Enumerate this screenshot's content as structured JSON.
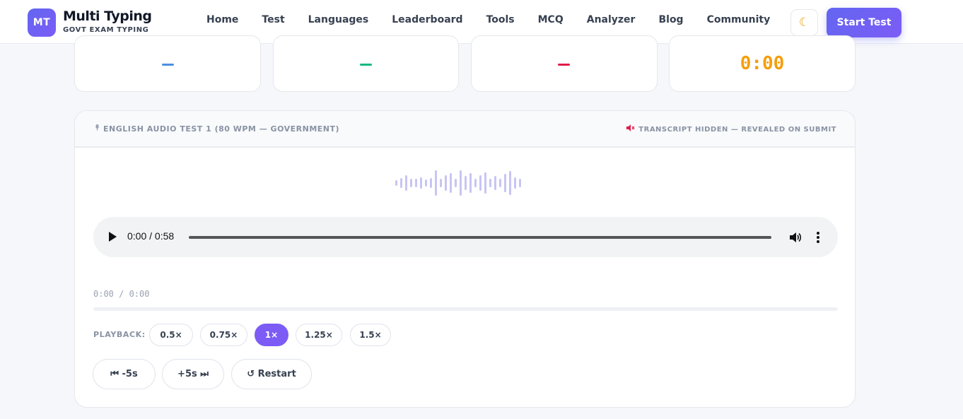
{
  "brand": {
    "badge": "MT",
    "name": "Multi Typing",
    "subtitle": "GOVT EXAM TYPING"
  },
  "nav": [
    "Home",
    "Test",
    "Languages",
    "Leaderboard",
    "Tools",
    "MCQ",
    "Analyzer",
    "Blog",
    "Community"
  ],
  "header": {
    "theme_icon": "moon-icon",
    "start_label": "Start Test"
  },
  "stats": [
    {
      "value": "",
      "color": "#4a90e2"
    },
    {
      "value": "",
      "color": "#10b981"
    },
    {
      "value": "",
      "color": "#e11d48"
    },
    {
      "value": "0:00",
      "color": "#f59e0b"
    }
  ],
  "audio_panel": {
    "title": "ENGLISH AUDIO TEST 1 (80 WPM — GOVERNMENT)",
    "title_icon": "mic-icon",
    "notice": "TRANSCRIPT HIDDEN — REVEALED ON SUBMIT",
    "notice_icon": "muted-speaker-icon",
    "player_time": "0:00 / 0:58",
    "elapsed": "0:00 / 0:00",
    "progress": 0,
    "playback_label": "PLAYBACK:",
    "speeds": [
      "0.5×",
      "0.75×",
      "1×",
      "1.25×",
      "1.5×"
    ],
    "active_speed": "1×",
    "controls": [
      "⏮ -5s",
      "+5s ⏭",
      "↺ Restart"
    ]
  },
  "colors": {
    "accent": "#7c5cf5",
    "timer": "#f59e0b"
  }
}
